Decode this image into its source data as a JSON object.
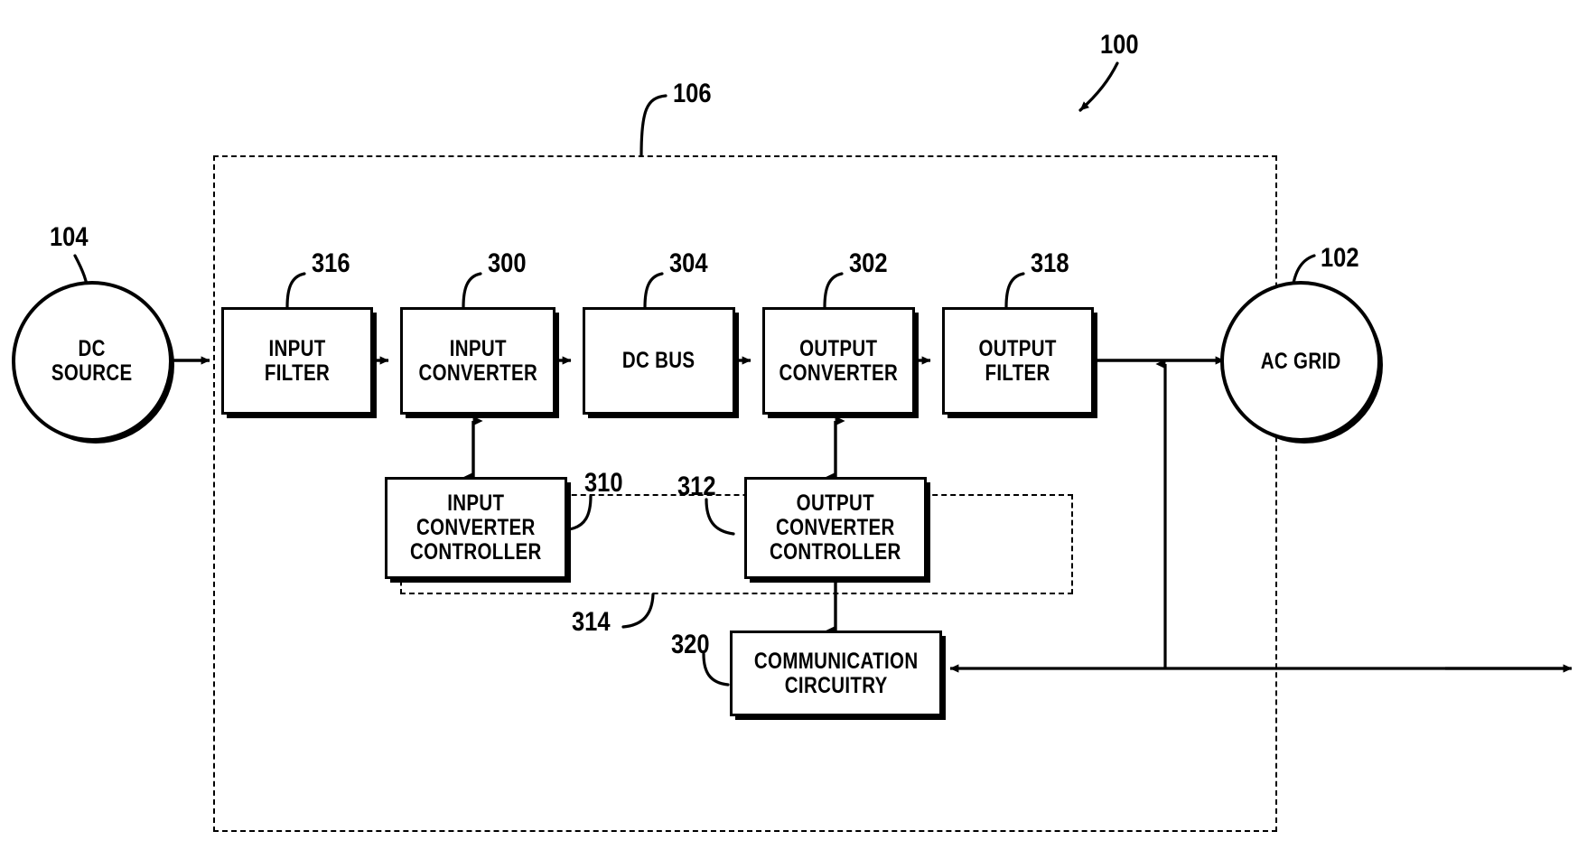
{
  "figure": {
    "title": "Power conversion system block diagram",
    "background_color": "#ffffff",
    "line_color": "#000000"
  },
  "nodes": {
    "dc_source": {
      "label": "DC\nSOURCE",
      "ref": "104",
      "shape": "circle"
    },
    "input_filter": {
      "label": "INPUT\nFILTER",
      "ref": "316",
      "shape": "rect"
    },
    "input_converter": {
      "label": "INPUT\nCONVERTER",
      "ref": "300",
      "shape": "rect"
    },
    "dc_bus": {
      "label": "DC BUS",
      "ref": "304",
      "shape": "rect"
    },
    "output_converter": {
      "label": "OUTPUT\nCONVERTER",
      "ref": "302",
      "shape": "rect"
    },
    "output_filter": {
      "label": "OUTPUT\nFILTER",
      "ref": "318",
      "shape": "rect"
    },
    "ac_grid": {
      "label": "AC GRID",
      "ref": "102",
      "shape": "circle"
    },
    "input_converter_controller": {
      "label": "INPUT\nCONVERTER\nCONTROLLER",
      "ref": "310",
      "shape": "rect"
    },
    "output_converter_controller": {
      "label": "OUTPUT\nCONVERTER\nCONTROLLER",
      "ref": "312",
      "shape": "rect"
    },
    "communication_circuitry": {
      "label": "COMMUNICATION\nCIRCUITRY",
      "ref": "320",
      "shape": "rect"
    }
  },
  "groups": {
    "system": {
      "ref": "100",
      "style": "arrow-callout"
    },
    "power_converter": {
      "ref": "106",
      "style": "dashed-box"
    },
    "controller_group": {
      "ref": "314",
      "style": "dashed-box"
    }
  },
  "refs": {
    "r100": "100",
    "r102": "102",
    "r104": "104",
    "r106": "106",
    "r300": "300",
    "r302": "302",
    "r304": "304",
    "r310": "310",
    "r312": "312",
    "r314": "314",
    "r316": "316",
    "r318": "318",
    "r320": "320"
  }
}
